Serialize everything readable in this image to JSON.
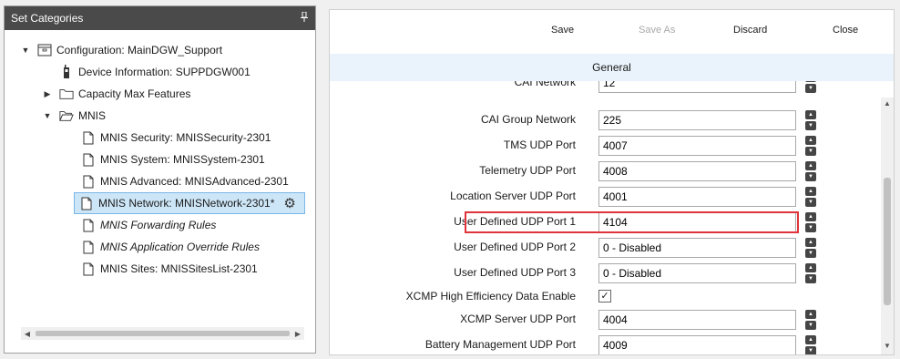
{
  "left_panel": {
    "title": "Set Categories",
    "pin_icon": "pin-icon",
    "tree": [
      {
        "label": "Configuration: MainDGW_Support",
        "expander": "▼",
        "icon": "configuration-icon",
        "italic": false
      },
      {
        "label": "Device Information: SUPPDGW001",
        "expander": "",
        "icon": "device-icon",
        "italic": false
      },
      {
        "label": "Capacity Max Features",
        "expander": "▶",
        "icon": "folder-icon",
        "italic": false
      },
      {
        "label": "MNIS",
        "expander": "▼",
        "icon": "folder-open-icon",
        "italic": false
      },
      {
        "label": "MNIS Security: MNISSecurity-2301",
        "expander": "",
        "icon": "document-icon",
        "italic": false
      },
      {
        "label": "MNIS System: MNISSystem-2301",
        "expander": "",
        "icon": "document-icon",
        "italic": false
      },
      {
        "label": "MNIS Advanced: MNISAdvanced-2301",
        "expander": "",
        "icon": "document-icon",
        "italic": false
      },
      {
        "label": "MNIS Network: MNISNetwork-2301*",
        "expander": "",
        "icon": "document-icon",
        "italic": false,
        "selected": true
      },
      {
        "label": "MNIS Forwarding Rules",
        "expander": "",
        "icon": "document-icon",
        "italic": true
      },
      {
        "label": "MNIS Application Override Rules",
        "expander": "",
        "icon": "document-icon",
        "italic": true
      },
      {
        "label": "MNIS Sites: MNISSitesList-2301",
        "expander": "",
        "icon": "document-icon",
        "italic": false
      }
    ]
  },
  "toolbar": {
    "save": "Save",
    "save_as": "Save As",
    "discard": "Discard",
    "close": "Close"
  },
  "section": {
    "title": "General"
  },
  "form": {
    "rows": [
      {
        "label": "CAI Network",
        "value": "12",
        "type": "text"
      },
      {
        "label": "CAI Group Network",
        "value": "225",
        "type": "text"
      },
      {
        "label": "TMS UDP Port",
        "value": "4007",
        "type": "text"
      },
      {
        "label": "Telemetry UDP Port",
        "value": "4008",
        "type": "text"
      },
      {
        "label": "Location Server UDP Port",
        "value": "4001",
        "type": "text"
      },
      {
        "label": "User Defined UDP Port 1",
        "value": "4104",
        "type": "text",
        "highlighted": true
      },
      {
        "label": "User Defined UDP Port 2",
        "value": "0 - Disabled",
        "type": "text"
      },
      {
        "label": "User Defined UDP Port 3",
        "value": "0 - Disabled",
        "type": "text"
      },
      {
        "label": "XCMP High Efficiency Data Enable",
        "value": true,
        "type": "checkbox"
      },
      {
        "label": "XCMP Server UDP Port",
        "value": "4004",
        "type": "text"
      },
      {
        "label": "Battery Management UDP Port",
        "value": "4009",
        "type": "text"
      }
    ]
  },
  "colors": {
    "header_bg": "#4a4a4a",
    "selected_bg": "#cde6f7",
    "highlight_border": "#e0343c",
    "section_bg": "#eaf3fb"
  }
}
